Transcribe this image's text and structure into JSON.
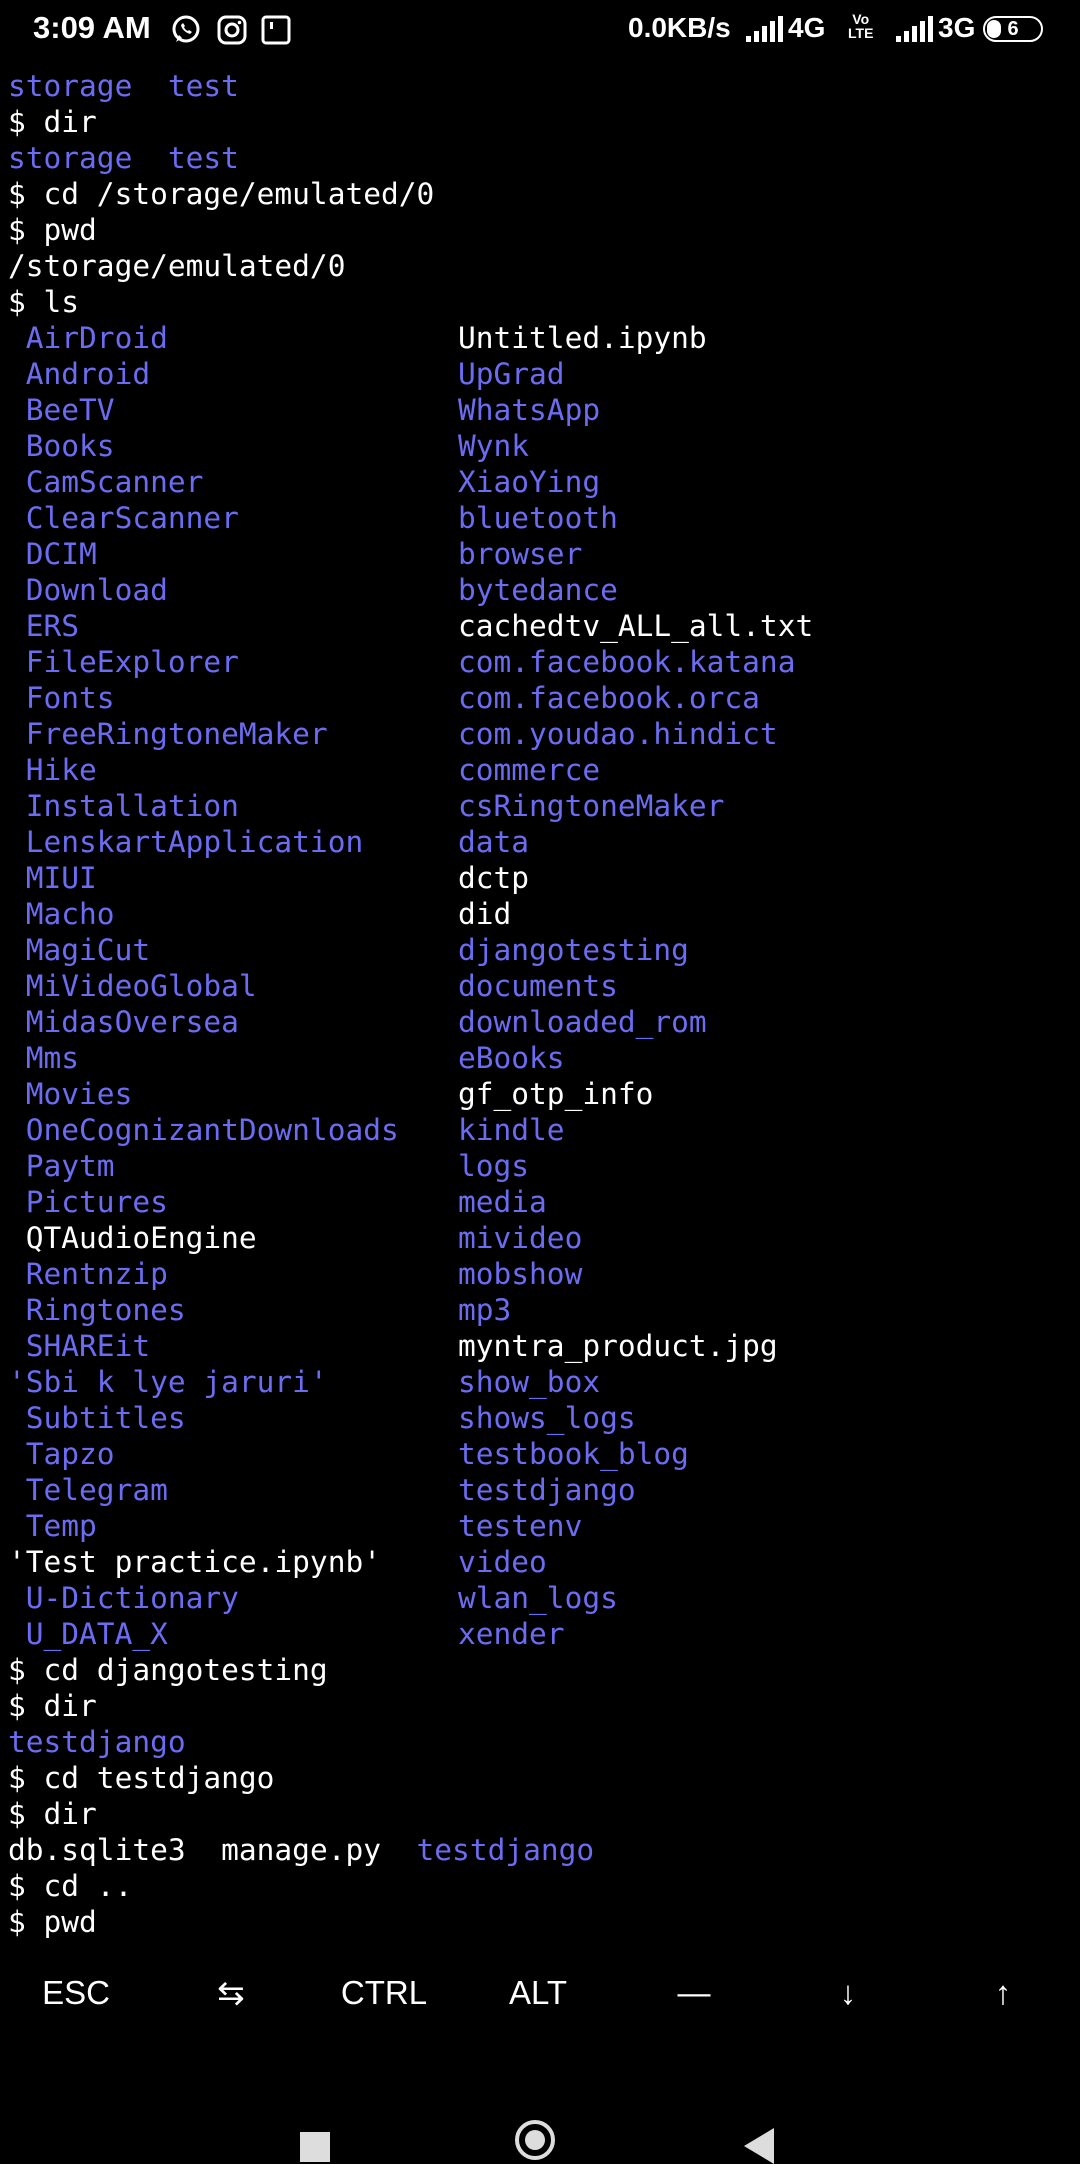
{
  "status_bar": {
    "time": "3:09 AM",
    "net_speed": "0.0KB/s",
    "sim1": "4G",
    "volte": "Vo\nLTE",
    "sim2": "3G",
    "battery": "6",
    "icons": [
      "whatsapp-icon",
      "instagram-icon",
      "notification-icon",
      "signal-icon",
      "signal-icon"
    ]
  },
  "terminal": {
    "colors": {
      "dir": "#6c6cf2",
      "file": "#ffffff"
    },
    "lines": [
      {
        "spans": [
          {
            "text": "storage",
            "kind": "dir"
          },
          {
            "text": "  "
          },
          {
            "text": "test",
            "kind": "dir"
          }
        ]
      },
      {
        "spans": [
          {
            "text": "$ dir"
          }
        ]
      },
      {
        "spans": [
          {
            "text": "storage",
            "kind": "dir"
          },
          {
            "text": "  "
          },
          {
            "text": "test",
            "kind": "dir"
          }
        ]
      },
      {
        "spans": [
          {
            "text": "$ cd /storage/emulated/0"
          }
        ]
      },
      {
        "spans": [
          {
            "text": "$ pwd"
          }
        ]
      },
      {
        "spans": [
          {
            "text": "/storage/emulated/0"
          }
        ]
      },
      {
        "spans": [
          {
            "text": "$ ls"
          }
        ]
      }
    ],
    "ls_rows": [
      [
        " AirDroid",
        "dir",
        "Untitled.ipynb",
        "file"
      ],
      [
        " Android",
        "dir",
        "UpGrad",
        "dir"
      ],
      [
        " BeeTV",
        "dir",
        "WhatsApp",
        "dir"
      ],
      [
        " Books",
        "dir",
        "Wynk",
        "dir"
      ],
      [
        " CamScanner",
        "dir",
        "XiaoYing",
        "dir"
      ],
      [
        " ClearScanner",
        "dir",
        "bluetooth",
        "dir"
      ],
      [
        " DCIM",
        "dir",
        "browser",
        "dir"
      ],
      [
        " Download",
        "dir",
        "bytedance",
        "dir"
      ],
      [
        " ERS",
        "dir",
        "cachedtv_ALL_all.txt",
        "file"
      ],
      [
        " FileExplorer",
        "dir",
        "com.facebook.katana",
        "dir"
      ],
      [
        " Fonts",
        "dir",
        "com.facebook.orca",
        "dir"
      ],
      [
        " FreeRingtoneMaker",
        "dir",
        "com.youdao.hindict",
        "dir"
      ],
      [
        " Hike",
        "dir",
        "commerce",
        "dir"
      ],
      [
        " Installation",
        "dir",
        "csRingtoneMaker",
        "dir"
      ],
      [
        " LenskartApplication",
        "dir",
        "data",
        "dir"
      ],
      [
        " MIUI",
        "dir",
        "dctp",
        "file"
      ],
      [
        " Macho",
        "dir",
        "did",
        "file"
      ],
      [
        " MagiCut",
        "dir",
        "djangotesting",
        "dir"
      ],
      [
        " MiVideoGlobal",
        "dir",
        "documents",
        "dir"
      ],
      [
        " MidasOversea",
        "dir",
        "downloaded_rom",
        "dir"
      ],
      [
        " Mms",
        "dir",
        "eBooks",
        "dir"
      ],
      [
        " Movies",
        "dir",
        "gf_otp_info",
        "file"
      ],
      [
        " OneCognizantDownloads",
        "dir",
        "kindle",
        "dir"
      ],
      [
        " Paytm",
        "dir",
        "logs",
        "dir"
      ],
      [
        " Pictures",
        "dir",
        "media",
        "dir"
      ],
      [
        " QTAudioEngine",
        "file",
        "mivideo",
        "dir"
      ],
      [
        " Rentnzip",
        "dir",
        "mobshow",
        "dir"
      ],
      [
        " Ringtones",
        "dir",
        "mp3",
        "dir"
      ],
      [
        " SHAREit",
        "dir",
        "myntra_product.jpg",
        "file"
      ],
      [
        "'Sbi k lye jaruri'",
        "dir",
        "show_box",
        "dir"
      ],
      [
        " Subtitles",
        "dir",
        "shows_logs",
        "dir"
      ],
      [
        " Tapzo",
        "dir",
        "testbook_blog",
        "dir"
      ],
      [
        " Telegram",
        "dir",
        "testdjango",
        "dir"
      ],
      [
        " Temp",
        "dir",
        "testenv",
        "dir"
      ],
      [
        "'Test practice.ipynb'",
        "file",
        "video",
        "dir"
      ],
      [
        " U-Dictionary",
        "dir",
        "wlan_logs",
        "dir"
      ],
      [
        " U_DATA_X",
        "dir",
        "xender",
        "dir"
      ]
    ],
    "tail_lines": [
      {
        "spans": [
          {
            "text": "$ cd djangotesting"
          }
        ]
      },
      {
        "spans": [
          {
            "text": "$ dir"
          }
        ]
      },
      {
        "spans": [
          {
            "text": "testdjango",
            "kind": "dir"
          }
        ]
      },
      {
        "spans": [
          {
            "text": "$ cd testdjango"
          }
        ]
      },
      {
        "spans": [
          {
            "text": "$ dir"
          }
        ]
      },
      {
        "spans": [
          {
            "text": "db.sqlite3"
          },
          {
            "text": "  "
          },
          {
            "text": "manage.py"
          },
          {
            "text": "  "
          },
          {
            "text": "testdjango",
            "kind": "dir"
          }
        ]
      },
      {
        "spans": [
          {
            "text": "$ cd .."
          }
        ]
      },
      {
        "spans": [
          {
            "text": "$ pwd"
          }
        ]
      }
    ]
  },
  "extra_keys": [
    {
      "label": "ESC",
      "name": "esc-key"
    },
    {
      "label": "⇆",
      "name": "tab-key"
    },
    {
      "label": "CTRL",
      "name": "ctrl-key"
    },
    {
      "label": "ALT",
      "name": "alt-key"
    },
    {
      "label": "—",
      "name": "dash-key"
    },
    {
      "label": "↓",
      "name": "down-arrow-key"
    },
    {
      "label": "↑",
      "name": "up-arrow-key"
    }
  ],
  "nav_bar": {
    "icons": [
      "recents-square-icon",
      "home-circle-icon",
      "back-triangle-icon"
    ]
  }
}
